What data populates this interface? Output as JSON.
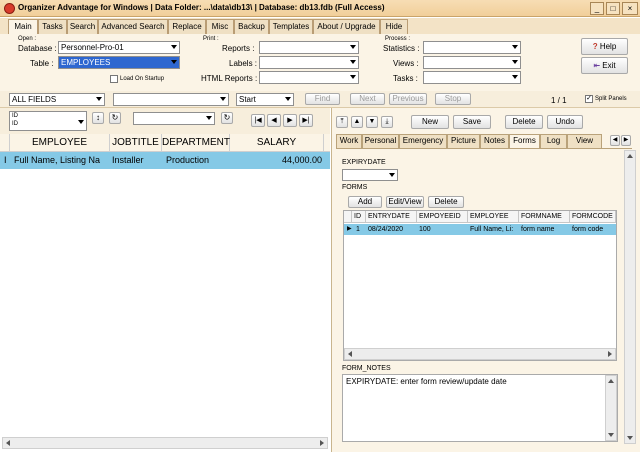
{
  "window": {
    "title": "Organizer Advantage for Windows  |  Data Folder: ...\\data\\db13\\  |  Database: db13.fdb (Full Access)",
    "minimize": "_",
    "maximize": "□",
    "close": "×"
  },
  "main_tabs": [
    "Main",
    "Tasks",
    "Search",
    "Advanced Search",
    "Replace",
    "Misc",
    "Backup",
    "Templates",
    "About / Upgrade",
    "Hide"
  ],
  "open_group": {
    "caption": "Open :",
    "database_label": "Database :",
    "database_value": "Personnel-Pro-01",
    "table_label": "Table :",
    "table_value": "EMPLOYEES",
    "load_on_startup": "Load On Startup"
  },
  "print_group": {
    "caption": "Print :",
    "reports_label": "Reports :",
    "labels_label": "Labels :",
    "html_reports_label": "HTML Reports :"
  },
  "process_group": {
    "caption": "Process :",
    "statistics_label": "Statistics :",
    "views_label": "Views :",
    "tasks_label": "Tasks :"
  },
  "help_button": "Help",
  "exit_button": "Exit",
  "search_bar": {
    "field_value": "ALL FIELDS",
    "match_value": "Start",
    "find": "Find",
    "next": "Next",
    "previous": "Previous",
    "stop": "Stop",
    "record_count": "1 / 1",
    "split_panels": "Split Panels"
  },
  "sort_bar": {
    "sort_field": "ID",
    "sort_field_sub": "ID"
  },
  "grid": {
    "columns": [
      "EMPLOYEE",
      "JOBTITLE",
      "DEPARTMENT",
      "SALARY"
    ],
    "rows": [
      {
        "marker": "I",
        "employee": "Full Name, Listing Na",
        "jobtitle": "Installer",
        "department": "Production",
        "salary": "44,000.00"
      }
    ]
  },
  "record_buttons": {
    "first": "|◀",
    "prev": "◀",
    "next": "▶",
    "last": "▶|",
    "new": "New",
    "save": "Save",
    "delete": "Delete",
    "undo": "Undo"
  },
  "detail_tabs": [
    "Work",
    "Personal",
    "Emergency",
    "Picture",
    "Notes",
    "Forms",
    "Log",
    "View"
  ],
  "forms_tab": {
    "expirydate_label": "EXPIRYDATE",
    "forms_label": "FORMS",
    "add": "Add",
    "edit_view": "Edit/View",
    "delete": "Delete",
    "columns": [
      "ID",
      "ENTRYDATE",
      "EMPOYEEID",
      "EMPLOYEE",
      "FORMNAME",
      "FORMCODE"
    ],
    "rows": [
      {
        "id": "1",
        "entrydate": "08/24/2020",
        "empoyeeid": "100",
        "employee": "Full Name, Li:",
        "formname": "form name",
        "formcode": "form code"
      }
    ],
    "form_notes_label": "FORM_NOTES",
    "form_notes_value": "EXPIRYDATE: enter form review/update date"
  },
  "colors": {
    "title_bg": "#f1cf9a",
    "panel_bg": "#fbf4e6",
    "selection": "#85c9e6",
    "combo_selected": "#2e67d0"
  }
}
